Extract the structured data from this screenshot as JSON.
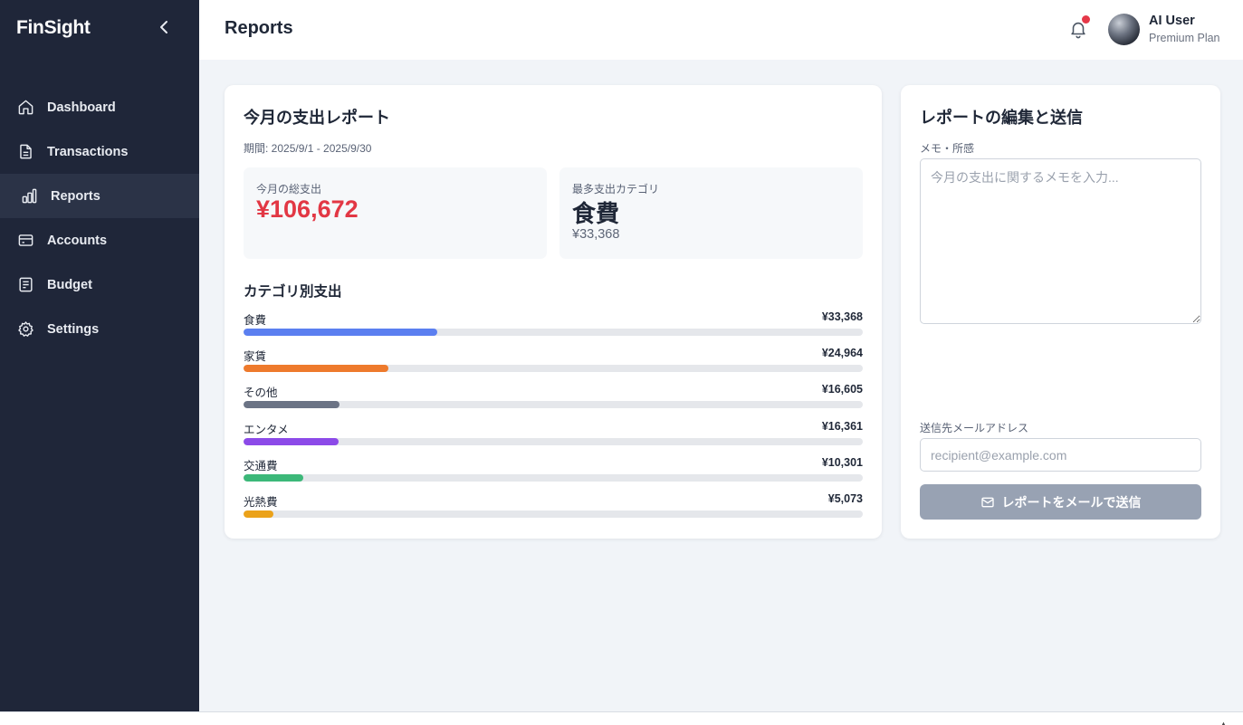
{
  "app": {
    "brand": "FinSight"
  },
  "sidebar": {
    "items": [
      {
        "label": "Dashboard",
        "icon": "home-icon"
      },
      {
        "label": "Transactions",
        "icon": "document-icon"
      },
      {
        "label": "Reports",
        "icon": "bar-chart-icon",
        "active": true
      },
      {
        "label": "Accounts",
        "icon": "card-icon"
      },
      {
        "label": "Budget",
        "icon": "ledger-icon"
      },
      {
        "label": "Settings",
        "icon": "gear-icon"
      }
    ]
  },
  "header": {
    "title": "Reports",
    "user": {
      "name": "AI User",
      "plan": "Premium Plan"
    },
    "notification_dot_color": "#e53848"
  },
  "report": {
    "title": "今月の支出レポート",
    "period": "期間: 2025/9/1 - 2025/9/30",
    "total": {
      "label": "今月の総支出",
      "value": "¥106,672"
    },
    "top_category": {
      "label": "最多支出カテゴリ",
      "name": "食費",
      "amount": "¥33,368"
    },
    "section_title": "カテゴリ別支出",
    "categories": [
      {
        "name": "食費",
        "value": "¥33,368",
        "amount": 33368,
        "color": "#5b7ff0"
      },
      {
        "name": "家賃",
        "value": "¥24,964",
        "amount": 24964,
        "color": "#ee7a2c"
      },
      {
        "name": "その他",
        "value": "¥16,605",
        "amount": 16605,
        "color": "#6b7385"
      },
      {
        "name": "エンタメ",
        "value": "¥16,361",
        "amount": 16361,
        "color": "#8c4ae8"
      },
      {
        "name": "交通費",
        "value": "¥10,301",
        "amount": 10301,
        "color": "#3cb879"
      },
      {
        "name": "光熱費",
        "value": "¥5,073",
        "amount": 5073,
        "color": "#eba21a"
      }
    ]
  },
  "send": {
    "title": "レポートの編集と送信",
    "memo_label": "メモ・所感",
    "memo_placeholder": "今月の支出に関するメモを入力...",
    "memo_value": "",
    "email_label": "送信先メールアドレス",
    "email_placeholder": "recipient@example.com",
    "email_value": "",
    "button_label": "レポートをメールで送信"
  }
}
